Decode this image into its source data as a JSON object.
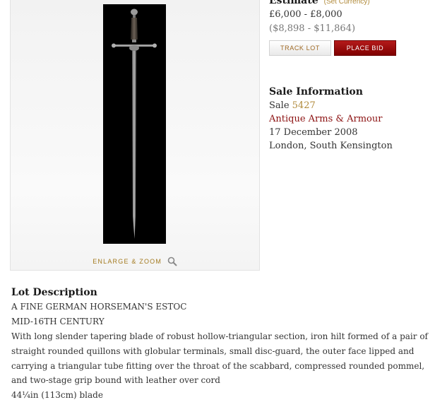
{
  "image_panel": {
    "enlarge_label": "ENLARGE & ZOOM",
    "zoom_icon": "magnifier-icon"
  },
  "estimate": {
    "heading": "Estimate",
    "set_currency": "(Set Currency)",
    "gbp": "£6,000 - £8,000",
    "usd": "($8,898 - $11,864)"
  },
  "buttons": {
    "track_lot": "TRACK LOT",
    "place_bid": "PLACE BID"
  },
  "sale_info": {
    "heading": "Sale Information",
    "sale_label": "Sale",
    "sale_number": "5427",
    "sale_name": "Antique Arms & Armour",
    "date": "17 December 2008",
    "location": "London, South Kensington"
  },
  "lot_description": {
    "heading": "Lot Description",
    "title": "A FINE GERMAN HORSEMAN'S ESTOC",
    "period": "MID-16TH CENTURY",
    "body": "With long slender tapering blade of robust hollow-triangular section, iron hilt formed of a pair of straight rounded quillons with globular terminals, small disc-guard, the outer face lipped and carrying a triangular tube fitting over the throat of the scabbard, compressed rounded pommel, and two-stage grip bound with leather over cord",
    "blade_length": "44¼in (113cm) blade"
  },
  "colors": {
    "link_gold": "#b08a3a",
    "link_red": "#8b1010",
    "bid_button": "#a01010"
  }
}
